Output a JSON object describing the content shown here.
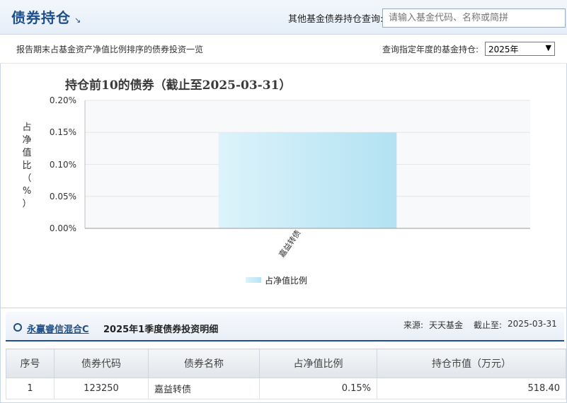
{
  "header": {
    "title": "债券持仓",
    "title_icon": "resize-arrow-icon",
    "search_label": "其他基金债券持仓查询:",
    "search_placeholder": "请输入基金代码、名称或简拼"
  },
  "subbar": {
    "note": "报告期末占基金资产净值比例排序的债券投资一览",
    "year_label": "查询指定年度的基金持仓:",
    "year_selected": "2025年"
  },
  "chart_data": {
    "type": "bar",
    "title": "持仓前10的债券（截止至2025-03-31）",
    "ylabel": "占净值比（%）",
    "ylabel_chars": [
      "占",
      "净",
      "值",
      "比",
      "（",
      "%",
      "）"
    ],
    "categories": [
      "嘉益转债"
    ],
    "series": [
      {
        "name": "占净值比例",
        "values": [
          0.15
        ]
      }
    ],
    "ylim": [
      0,
      0.2
    ],
    "yticks": [
      0,
      0.05,
      0.1,
      0.15,
      0.2
    ],
    "ytick_labels": [
      "0.00%",
      "0.05%",
      "0.10%",
      "0.15%",
      "0.20%"
    ],
    "grid": true,
    "legend": "bottom-center",
    "bar_color": "#c7ecf8"
  },
  "detail": {
    "fund_name": "永赢睿信混合C",
    "title": "2025年1季度债券投资明细",
    "source_label": "来源:",
    "source_value": "天天基金",
    "asof_label": "截止至:",
    "asof_value": "2025-03-31",
    "columns": [
      "序号",
      "债券代码",
      "债券名称",
      "占净值比例",
      "持仓市值（万元）"
    ],
    "rows": [
      {
        "no": "1",
        "code": "123250",
        "name": "嘉益转债",
        "ratio": "0.15%",
        "value": "518.40"
      }
    ]
  },
  "colors": {
    "accent": "#1f4f8a",
    "header_bg": "#e6eef8"
  }
}
